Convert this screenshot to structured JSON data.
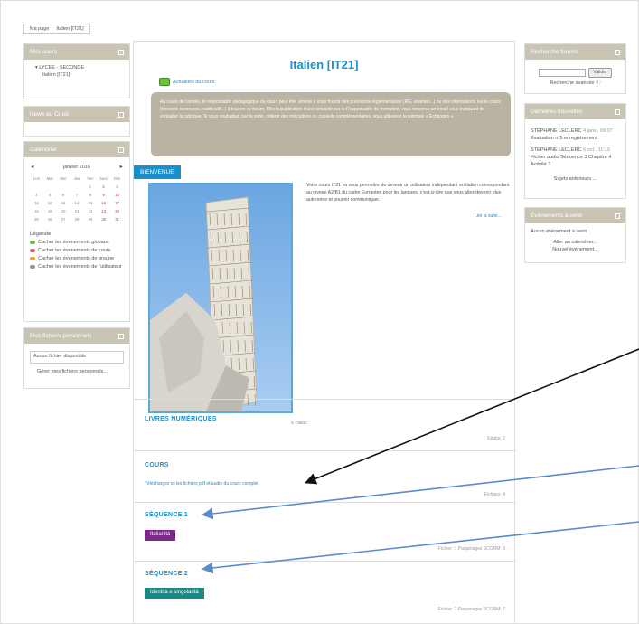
{
  "breadcrumb": {
    "home": "Ma page",
    "course": "Italien [IT21]"
  },
  "left": {
    "my_courses": {
      "title": "Mes cours",
      "category": "LYCEE - SECONDE",
      "course": "Italien [IT21]"
    },
    "news_cned": {
      "title": "News du Cned"
    },
    "calendar": {
      "title": "Calendrier",
      "prev": "◄",
      "next": "►",
      "month": "janvier 2016",
      "days": [
        "Lun",
        "Mar",
        "Mer",
        "Jeu",
        "Ven",
        "Sam",
        "Dim"
      ],
      "weeks": [
        [
          "",
          "",
          "",
          "",
          "1",
          "2",
          "3"
        ],
        [
          "4",
          "5",
          "6",
          "7",
          "8",
          "9",
          "10"
        ],
        [
          "11",
          "12",
          "13",
          "14",
          "15",
          "16",
          "17"
        ],
        [
          "18",
          "19",
          "20",
          "21",
          "22",
          "23",
          "24"
        ],
        [
          "25",
          "26",
          "27",
          "28",
          "29",
          "30",
          "31"
        ]
      ],
      "legend_title": "Légende",
      "legend": [
        {
          "label": "Cacher les événements globaux",
          "color": "#6fbf3f"
        },
        {
          "label": "Cacher les événements de cours",
          "color": "#e06666"
        },
        {
          "label": "Cacher les événements de groupe",
          "color": "#f0a030"
        },
        {
          "label": "Cacher les événements de l'utilisateur",
          "color": "#999999"
        }
      ]
    },
    "files": {
      "title": "Mes fichiers personnels",
      "empty": "Aucun fichier disponible",
      "manage": "Gérer mes fichiers personnels..."
    }
  },
  "main": {
    "title": "Italien [IT21]",
    "news_link": "Actualités du cours",
    "info_text": "Au cours de l'année, le responsable pédagogique du cours peut être amené à vous fournir des précisions réglementaires (RG, examen...) ou des informations sur le cours (nouvelle ressource, rectificatif...) à travers ce forum. Dès la publication d'une actualité par le Responsable de formation, vous recevrez un email vous indiquant de consulter la rubrique. Si vous souhaitez, par la suite, obtenir des indications ou conseils complémentaires, vous utiliserez la rubrique « Échanges ».",
    "welcome_tab": "BIENVENUE",
    "intro_text": "Votre cours IT21 va vous permettre de devenir un utilisateur indépendant en italien correspondant au niveau A2/B1 du cadre Européen pour les langues, c'est-à-dire que vous allez devenir plus autonome et pouvoir communiquer.",
    "read_more": "Lire la suite...",
    "image_caption": "© CNED",
    "sections": [
      {
        "title": "LIVRES NUMÉRIQUES",
        "meta": "Epubs: 2"
      },
      {
        "title": "COURS",
        "link": "Téléchargez ici les fichiers pdf et audio du cours complet",
        "meta": "Fichiers: 4"
      },
      {
        "title": "SÉQUENCE 1",
        "badge": "Italianità",
        "badge_color": "#7b2a8a",
        "meta": "Fichier: 1    Paquetages SCORM: 8"
      },
      {
        "title": "SÉQUENCE 2",
        "badge": "Identità e singolarità",
        "badge_color": "#1c8a82",
        "meta": "Fichier: 1    Paquetages SCORM: 7"
      }
    ]
  },
  "right": {
    "forum_search": {
      "title": "Recherche forums",
      "button": "Valider",
      "advanced": "Recherche avancée"
    },
    "latest_news": {
      "title": "Dernières nouvelles",
      "items": [
        {
          "author": "STEPHANE LECLERC",
          "date": "4 janv., 09:07",
          "text": "Évaluation n°5 enregistrement"
        },
        {
          "author": "STEPHANE LECLERC",
          "date": "6 oct., 11:19",
          "text": "Fichier audio Séquence 3 Chapitre 4 Activité 3"
        }
      ],
      "older": "Sujets antérieurs ..."
    },
    "upcoming": {
      "title": "Événements à venir",
      "none": "Aucun événement à venir",
      "calendar": "Aller au calendrier...",
      "new": "Nouvel événement..."
    }
  }
}
